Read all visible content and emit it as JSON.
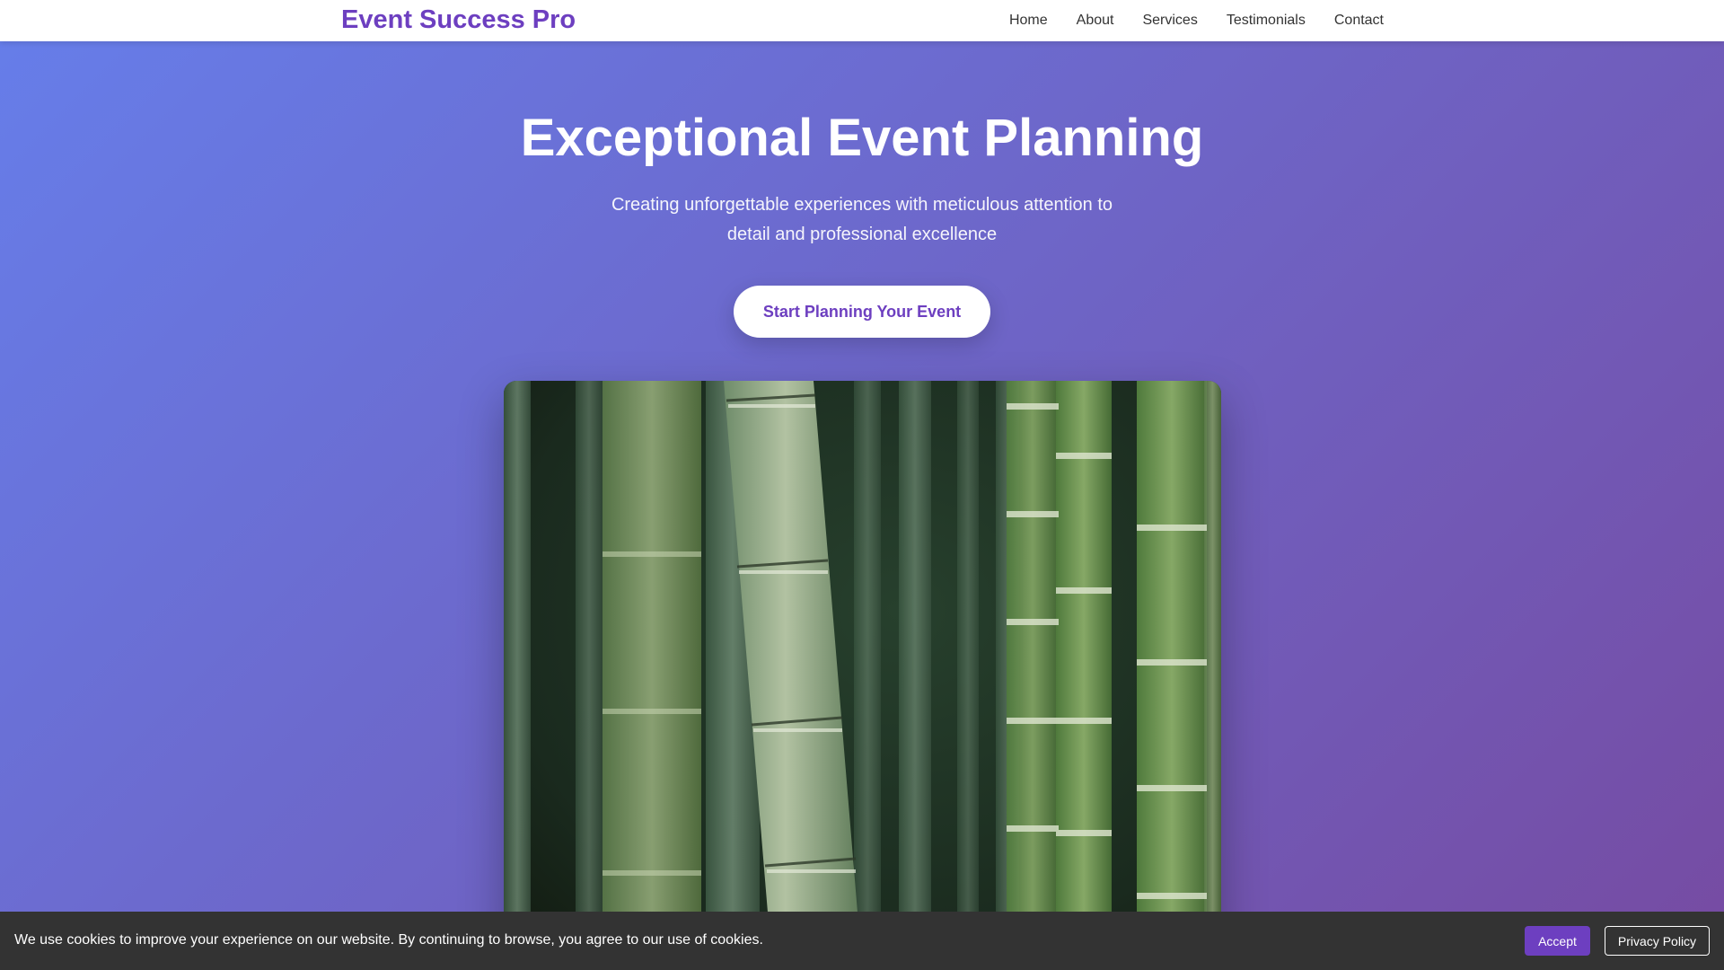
{
  "navbar": {
    "brand": "Event Success Pro",
    "links": [
      {
        "label": "Home"
      },
      {
        "label": "About"
      },
      {
        "label": "Services"
      },
      {
        "label": "Testimonials"
      },
      {
        "label": "Contact"
      }
    ]
  },
  "hero": {
    "title": "Exceptional Event Planning",
    "subtitle": "Creating unforgettable experiences with meticulous attention to detail and professional excellence",
    "cta_label": "Start Planning Your Event"
  },
  "cookie_banner": {
    "message": "We use cookies to improve your experience on our website. By continuing to browse, you agree to our use of cookies.",
    "accept_label": "Accept",
    "privacy_label": "Privacy Policy"
  },
  "colors": {
    "brand": "#6d3fc0",
    "gradient_start": "#667eea",
    "gradient_end": "#764ba2",
    "banner_bg": "#333333"
  },
  "icons": {
    "hero_image": "bamboo-photo"
  }
}
